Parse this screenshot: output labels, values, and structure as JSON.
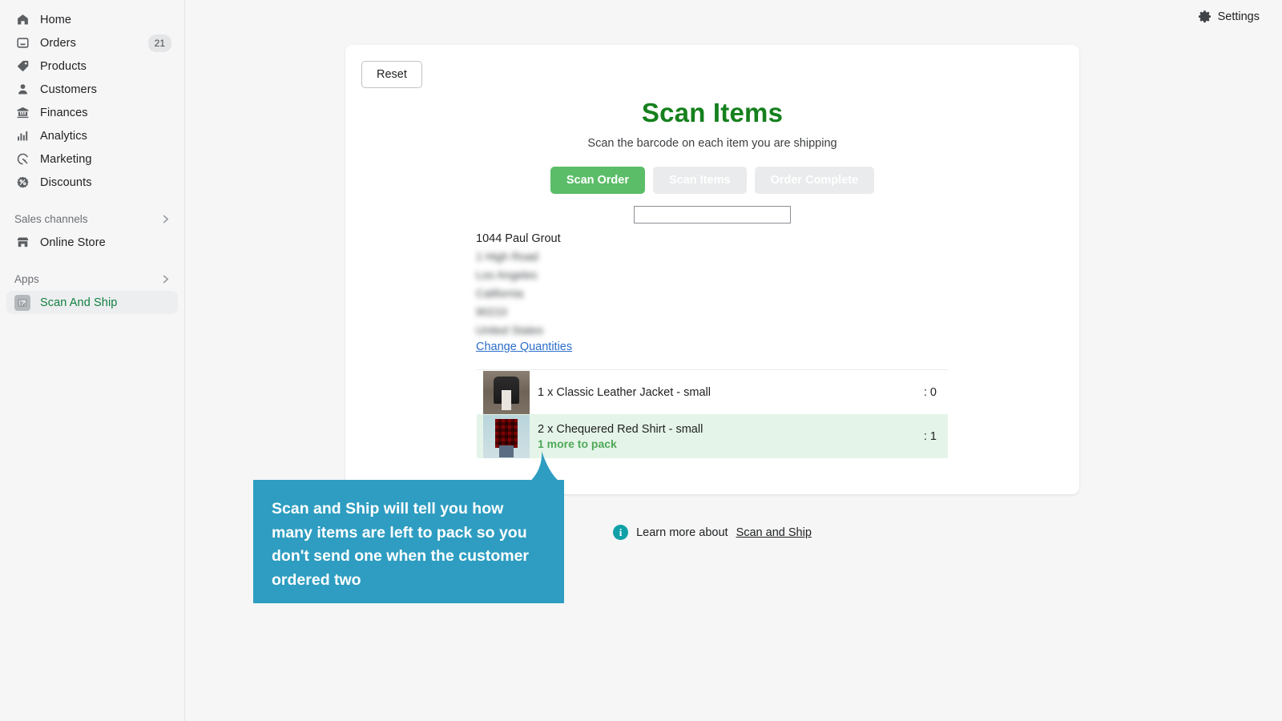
{
  "sidebar": {
    "items": [
      {
        "label": "Home",
        "icon": "home-icon",
        "badge": ""
      },
      {
        "label": "Orders",
        "icon": "inbox-icon",
        "badge": "21"
      },
      {
        "label": "Products",
        "icon": "tag-icon",
        "badge": ""
      },
      {
        "label": "Customers",
        "icon": "person-icon",
        "badge": ""
      },
      {
        "label": "Finances",
        "icon": "bank-icon",
        "badge": ""
      },
      {
        "label": "Analytics",
        "icon": "bar-chart-icon",
        "badge": ""
      },
      {
        "label": "Marketing",
        "icon": "marketing-target-icon",
        "badge": ""
      },
      {
        "label": "Discounts",
        "icon": "discount-percent-icon",
        "badge": ""
      }
    ],
    "sections": [
      {
        "header": "Sales channels",
        "items": [
          {
            "label": "Online Store",
            "icon": "storefront-icon"
          }
        ]
      },
      {
        "header": "Apps",
        "items": [
          {
            "label": "Scan And Ship",
            "icon": "app-scan-icon",
            "active": true
          }
        ]
      }
    ]
  },
  "topbar": {
    "settings_label": "Settings",
    "settings_icon": "gear-icon"
  },
  "card": {
    "reset_label": "Reset",
    "title": "Scan Items",
    "subtitle": "Scan the barcode on each item you are shipping",
    "steps": [
      {
        "label": "Scan Order",
        "state": "active"
      },
      {
        "label": "Scan Items",
        "state": "disabled"
      },
      {
        "label": "Order Complete",
        "state": "disabled"
      }
    ],
    "scan_input": {
      "value": "",
      "placeholder": ""
    },
    "order": {
      "summary": "1044 Paul Grout",
      "address_lines": [
        "1 High Road",
        "Los Angeles",
        "California",
        "90210",
        "United States"
      ]
    },
    "change_quantities_label": "Change Quantities",
    "items": [
      {
        "title": "1 x Classic Leather Jacket - small",
        "note": "",
        "count": ": 0",
        "thumb": "classic-leather-jacket-thumbnail",
        "highlighted": false
      },
      {
        "title": "2 x Chequered Red Shirt - small",
        "note": "1 more to pack",
        "count": ": 1",
        "thumb": "chequered-red-shirt-thumbnail",
        "highlighted": true
      }
    ]
  },
  "footer": {
    "info_icon": "info-circle-icon",
    "text": "Learn more about",
    "link": "Scan and Ship"
  },
  "callout": {
    "text": "Scan and Ship will tell you how many items are left to pack so you don't send one when the customer ordered two"
  },
  "colors": {
    "page_background": "#f6f6f7",
    "card_background": "#ffffff",
    "title_green": "#15801d",
    "step_active_green": "#5bbd68",
    "step_disabled_grey": "#e9ebec",
    "row_highlight_green": "#e5f4e8",
    "note_green": "#4ea858",
    "link_blue": "#2c6ecb",
    "sidebar_active_text": "#108043",
    "callout_blue": "#2e9dc1",
    "info_teal": "#12a0a8"
  }
}
